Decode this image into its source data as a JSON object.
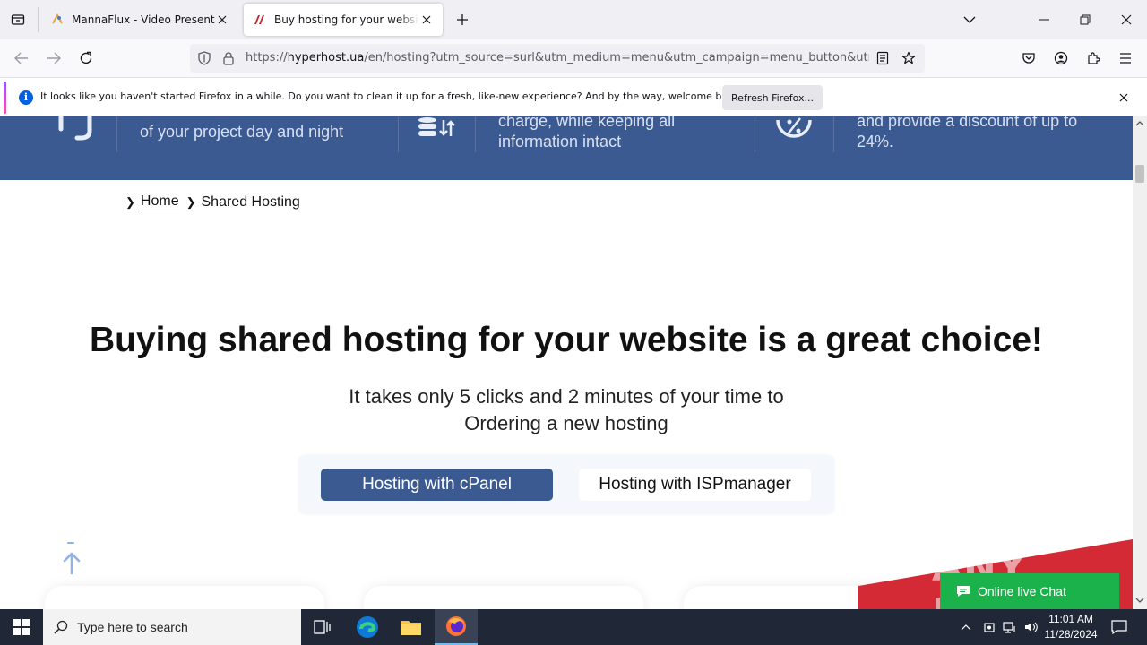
{
  "tabs": [
    {
      "title": "MannaFlux - Video Presentation",
      "active": false
    },
    {
      "title": "Buy hosting for your website. Re",
      "active": true
    }
  ],
  "url": {
    "prefix": "https://",
    "host": "hyperhost.ua",
    "path": "/en/hosting?utm_source=surl&utm_medium=menu&utm_campaign=menu_button&utm_co"
  },
  "notification": {
    "text": "It looks like you haven't started Firefox in a while. Do you want to clean it up for a fresh, like-new experience? And by the way, welcome back!",
    "button": "Refresh Firefox..."
  },
  "features": [
    {
      "line1": "of your project day and night"
    },
    {
      "line1": "charge, while keeping all",
      "line2": "information intact"
    },
    {
      "line1": "and provide a discount of up to",
      "line2": "24%."
    }
  ],
  "breadcrumb": {
    "home": "Home",
    "current": "Shared Hosting"
  },
  "headline": "Buying shared hosting for your website is a great choice!",
  "subline": {
    "line1": "It takes only 5 clicks and 2 minutes of your time to",
    "line2": "Ordering a new hosting"
  },
  "switcher": {
    "cpanel": "Hosting with cPanel",
    "isp": "Hosting with ISPmanager"
  },
  "chat": {
    "label": "Online live Chat"
  },
  "watermark": "ANY RUN",
  "taskbar": {
    "search_placeholder": "Type here to search",
    "time": "11:01 AM",
    "date": "11/28/2024"
  },
  "colors": {
    "brand_blue": "#3c5a92",
    "chat_green": "#1bb24b",
    "ribbon_red": "#d42a35"
  }
}
